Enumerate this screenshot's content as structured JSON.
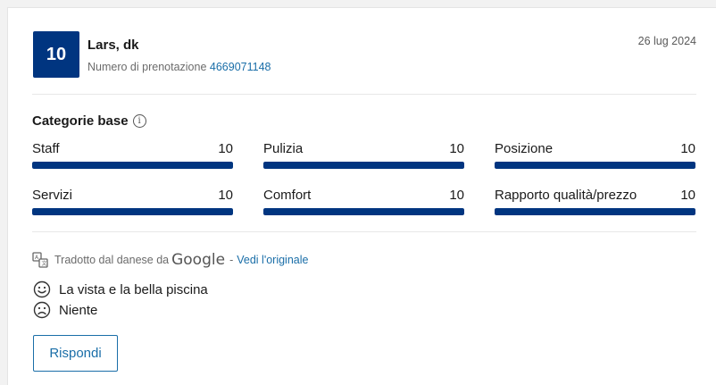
{
  "review": {
    "score": "10",
    "reviewer_name": "Lars, dk",
    "booking_label": "Numero di prenotazione",
    "booking_number": "4669071148",
    "date": "26 lug 2024"
  },
  "categories": {
    "title": "Categorie base",
    "items": [
      {
        "label": "Staff",
        "score": "10",
        "fraction": 1.0
      },
      {
        "label": "Pulizia",
        "score": "10",
        "fraction": 1.0
      },
      {
        "label": "Posizione",
        "score": "10",
        "fraction": 1.0
      },
      {
        "label": "Servizi",
        "score": "10",
        "fraction": 1.0
      },
      {
        "label": "Comfort",
        "score": "10",
        "fraction": 1.0
      },
      {
        "label": "Rapporto qualità/prezzo",
        "score": "10",
        "fraction": 1.0
      }
    ]
  },
  "translation": {
    "text": "Tradotto dal danese da",
    "provider": "Google",
    "separator": "-",
    "link": "Vedi l'originale"
  },
  "comments": {
    "positive": "La vista e la bella piscina",
    "negative": "Niente"
  },
  "actions": {
    "reply_label": "Rispondi"
  },
  "colors": {
    "brand_blue": "#003580",
    "link_blue": "#1a6ea8"
  },
  "icons": {
    "info": "info-icon",
    "translate": "translate-icon",
    "positive": "smile-icon",
    "negative": "frown-icon"
  }
}
